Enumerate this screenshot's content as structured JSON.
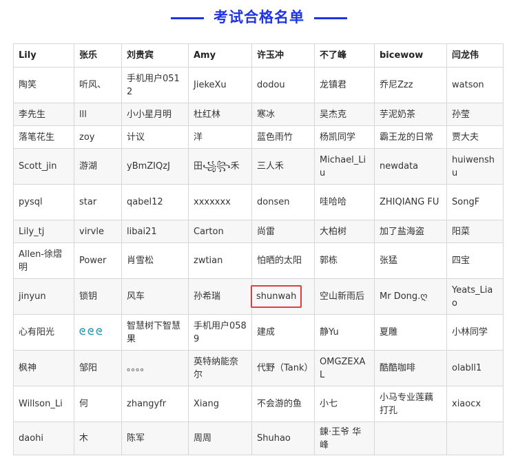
{
  "title": "考试合格名单",
  "highlight_color": "#e53a3a",
  "title_color": "#1f33e6",
  "headers": [
    "Lily",
    "张乐",
    "刘贵宾",
    "Amy",
    "许玉冲",
    "不了峰",
    "bicewow",
    "闫龙伟"
  ],
  "rows": [
    [
      "陶笑",
      "听风、",
      "手机用户0512",
      "JiekeXu",
      "dodou",
      "龙镇君",
      "乔尼Zzz",
      "watson"
    ],
    [
      "李先生",
      "lll",
      "小小星月明",
      "杜红林",
      "寒冰",
      "吴杰克",
      "芋泥奶茶",
      "孙莹"
    ],
    [
      "落笔花生",
      "zoy",
      "计议",
      "洋",
      "蓝色雨竹",
      "杨凯同学",
      "霸王龙的日常",
      "贾大夫"
    ],
    [
      "Scott_jin",
      "游湖",
      "yBmZIQzJ",
      "田꧁꧂禾",
      "三人禾",
      "Michael_Liu",
      "newdata",
      "huiwenshu"
    ],
    [
      "pysql",
      "star",
      "qabel12",
      "xxxxxxx",
      "donsen",
      "哇哈哈",
      "ZHIQIANG FU",
      "SongF"
    ],
    [
      "Lily_tj",
      "virvle",
      "libai21",
      "Carton",
      "尚雷",
      "大柏树",
      "加了盐海盗",
      "阳菜"
    ],
    [
      "Allen-徐熠明",
      "Power",
      "肖雪松",
      "zwtian",
      "怕晒的太阳",
      "郭栋",
      "张猛",
      "四宝"
    ],
    [
      "jinyun",
      "锁钥",
      "风车",
      "孙希瑞",
      "shunwah",
      "空山新雨后",
      "Mr Dong.ღ",
      "Yeats_Liao"
    ],
    [
      "心有阳光",
      "ᘓᘓᘓ",
      "智慧树下智慧果",
      "手机用户0589",
      "建成",
      "静Yu",
      "夏雕",
      "小林同学"
    ],
    [
      "枫神",
      "邹阳",
      "。。。。",
      "英特纳能奈尔",
      "代野（Tank）",
      "OMGZEXAL",
      "酷酷咖啡",
      "olabll1"
    ],
    [
      "Willson_Li",
      "何",
      "zhangyfr",
      "Xiang",
      "不会游的鱼",
      "小七",
      "小马专业莲藕打孔",
      "xiaocx"
    ],
    [
      "daohi",
      "木",
      "陈军",
      "周周",
      "Shuhao",
      "鍊·王爷 华峰",
      "",
      ""
    ]
  ]
}
